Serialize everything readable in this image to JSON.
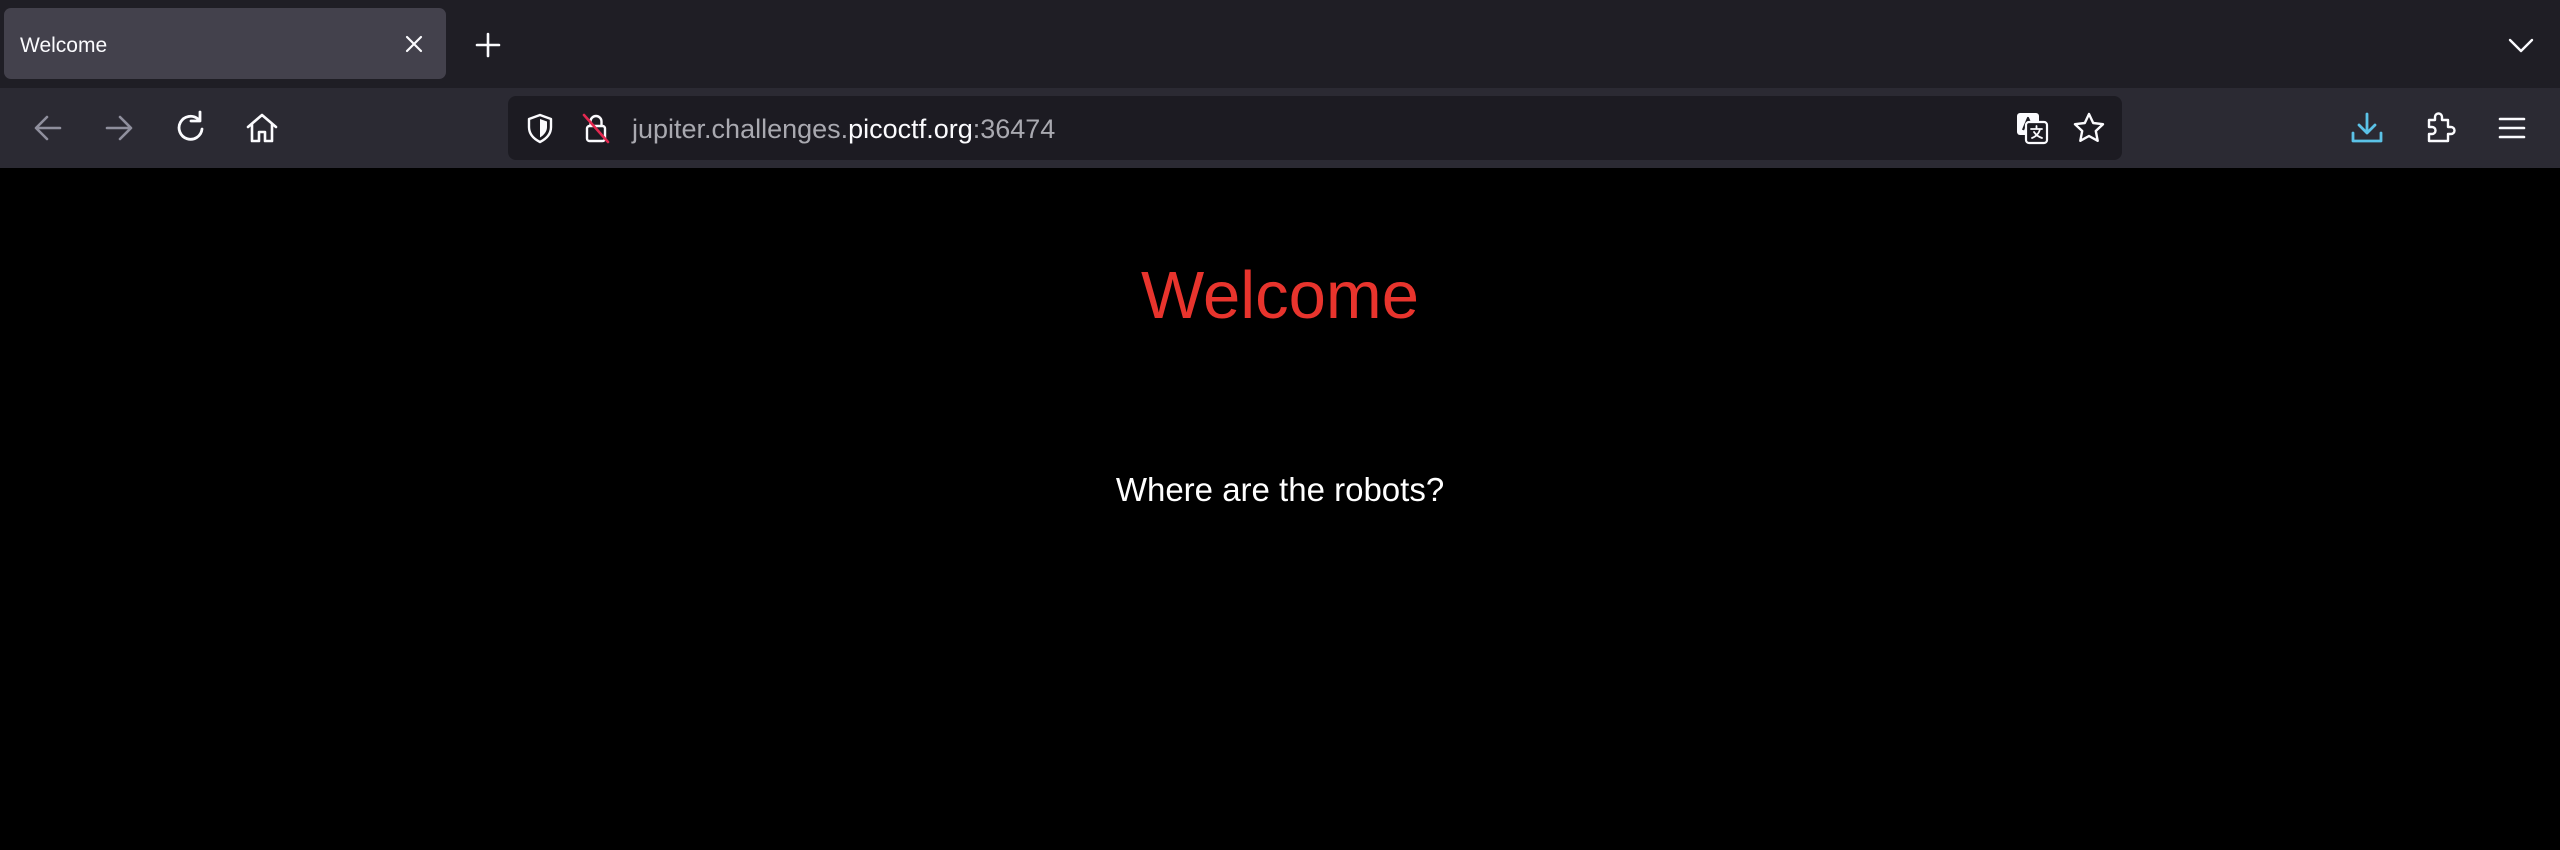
{
  "browser": {
    "tab": {
      "title": "Welcome"
    },
    "url": {
      "prefix": "jupiter.challenges.",
      "host": "picoctf.org",
      "suffix": ":36474"
    },
    "icons": {
      "tab_close": "close-icon",
      "new_tab": "plus-icon",
      "tab_list": "chevron-down-icon",
      "back": "arrow-left-icon",
      "forward": "arrow-right-icon",
      "reload": "reload-icon",
      "home": "home-icon",
      "tracking_protection": "shield-icon",
      "insecure_connection": "lock-strikethrough-icon",
      "translate": "translate-icon",
      "bookmark": "star-icon",
      "downloads": "download-icon",
      "extensions": "puzzle-icon",
      "menu": "hamburger-menu-icon"
    }
  },
  "page": {
    "heading": "Welcome",
    "text": "Where are the robots?"
  },
  "colors": {
    "tabstrip_bg": "#1f1e25",
    "active_tab_bg": "#43414c",
    "navbar_bg": "#2b2a33",
    "urlbar_bg": "#1c1b22",
    "page_bg": "#000000",
    "heading": "#e8342d",
    "text": "#ffffff",
    "download_accent": "#5bc2e7"
  }
}
